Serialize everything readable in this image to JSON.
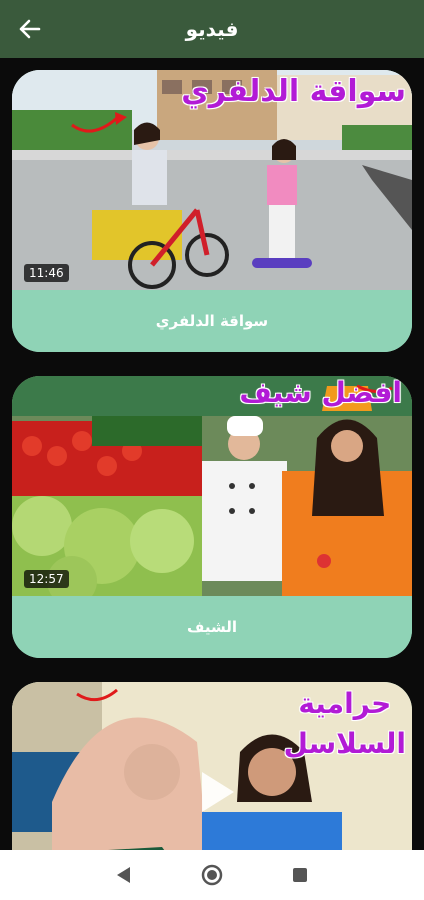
{
  "header": {
    "title": "فيديو"
  },
  "videos": [
    {
      "overlay": "سواقة الدلفري",
      "duration": "11:46",
      "caption": "سواقة الدلفري"
    },
    {
      "overlay": "افضل شيف",
      "duration": "12:57",
      "caption": "الشيف"
    },
    {
      "overlay_line1": "حرامية",
      "overlay_line2": "السلاسل"
    }
  ],
  "icons": {
    "back": "arrow-left-icon",
    "nav_back": "triangle-back-icon",
    "nav_home": "circle-home-icon",
    "nav_recents": "square-recents-icon"
  },
  "colors": {
    "topbar": "#3a5a3c",
    "caption_bg": "#8fd3b6",
    "overlay_text": "#b21bd6"
  }
}
